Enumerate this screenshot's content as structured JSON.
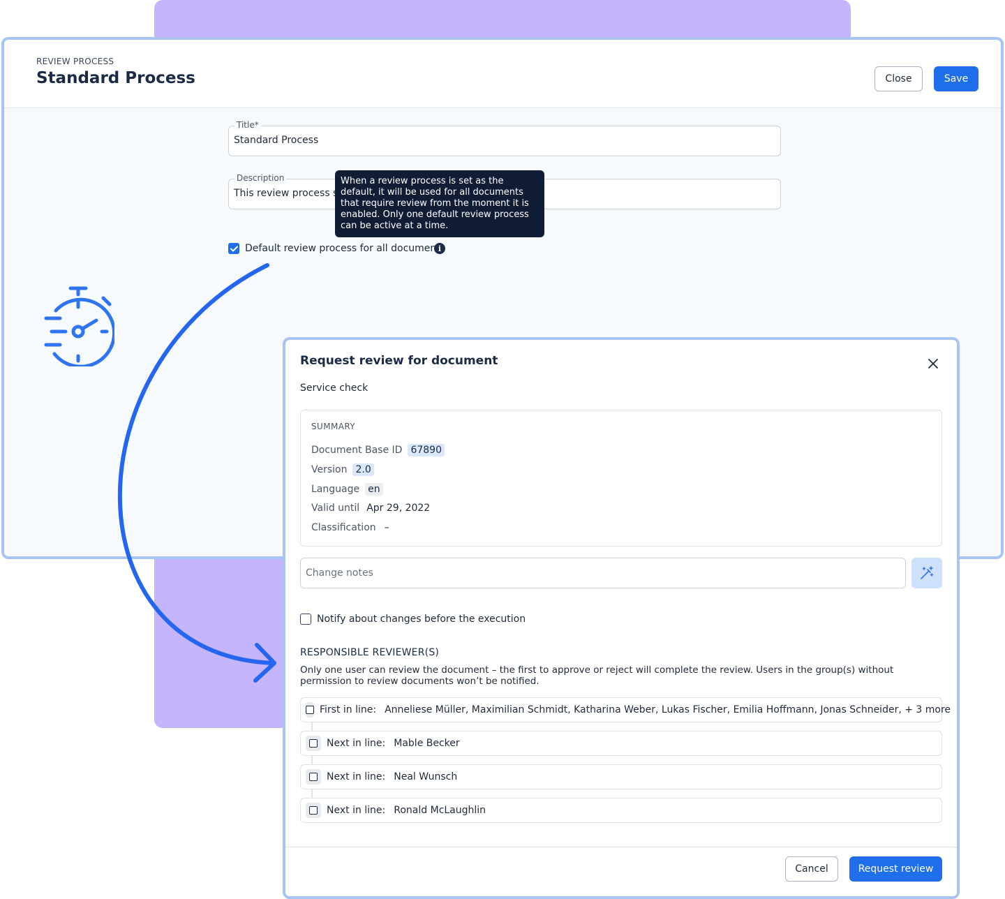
{
  "review_process": {
    "overline": "REVIEW PROCESS",
    "title": "Standard Process",
    "close_label": "Close",
    "save_label": "Save",
    "title_field": {
      "label": "Title*",
      "value": "Standard Process"
    },
    "description_field": {
      "label": "Description",
      "value": "This review process sh"
    },
    "default_checkbox": {
      "label": "Default review process for all documents",
      "checked": true
    },
    "tooltip": "When a review process is set as the default, it will be used for all documents that require review from the moment it is enabled. Only one default review process can be active at a time."
  },
  "modal": {
    "title": "Request review for document",
    "subtitle": "Service check",
    "summary": {
      "heading": "SUMMARY",
      "rows": [
        {
          "key": "Document Base ID",
          "value": "67890"
        },
        {
          "key": "Version",
          "value": "2.0"
        },
        {
          "key": "Language",
          "value": "en"
        },
        {
          "key": "Valid until",
          "value": "Apr 29, 2022"
        },
        {
          "key": "Classification",
          "value": "–"
        }
      ]
    },
    "change_notes_placeholder": "Change notes",
    "notify_label": "Notify about changes before the execution",
    "reviewers_heading": "RESPONSIBLE REVIEWER(S)",
    "reviewers_description": "Only one user can review the document – the first to approve or reject will complete the review. Users in the group(s) without permission to review documents won’t be notified.",
    "reviewers": [
      {
        "prefix": "First in line:",
        "names": "Anneliese Müller, Maximilian Schmidt, Katharina Weber, Lukas Fischer, Emilia Hoffmann, Jonas Schneider, + 3 more"
      },
      {
        "prefix": "Next in line:",
        "names": "Mable Becker"
      },
      {
        "prefix": "Next in line:",
        "names": "Neal Wunsch"
      },
      {
        "prefix": "Next in line:",
        "names": "Ronald McLaughlin"
      }
    ],
    "cancel_label": "Cancel",
    "request_label": "Request review"
  },
  "colors": {
    "primary": "#1f6feb",
    "purple_backdrop": "#c4b5fd",
    "window_border": "#a7c4f5",
    "tooltip_bg": "#111c35",
    "heading": "#1b2b45"
  },
  "icons": [
    "stopwatch-icon",
    "info-icon",
    "close-icon",
    "magic-wand-icon",
    "check-icon",
    "curved-arrow"
  ]
}
